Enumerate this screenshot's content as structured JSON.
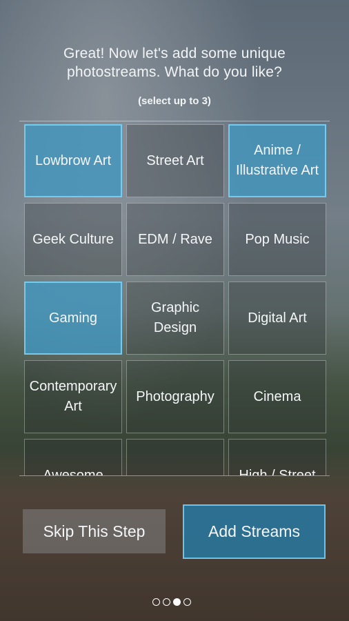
{
  "heading": {
    "line1": "Great! Now let's add some unique",
    "line2": "photostreams. What do you like?"
  },
  "subheading": "(select up to 3)",
  "tiles": [
    {
      "label": "Lowbrow Art",
      "selected": true
    },
    {
      "label": "Street Art",
      "selected": false
    },
    {
      "label": "Anime /\nIllustrative Art",
      "selected": true
    },
    {
      "label": "Geek Culture",
      "selected": false
    },
    {
      "label": "EDM / Rave",
      "selected": false
    },
    {
      "label": "Pop Music",
      "selected": false
    },
    {
      "label": "Gaming",
      "selected": true
    },
    {
      "label": "Graphic\nDesign",
      "selected": false
    },
    {
      "label": "Digital Art",
      "selected": false
    },
    {
      "label": "Contemporary\nArt",
      "selected": false
    },
    {
      "label": "Photography",
      "selected": false
    },
    {
      "label": "Cinema",
      "selected": false
    },
    {
      "label": "Awesome",
      "selected": false
    },
    {
      "label": "",
      "selected": false
    },
    {
      "label": "High / Street",
      "selected": false
    }
  ],
  "buttons": {
    "skip": "Skip This Step",
    "add": "Add Streams"
  },
  "pager": {
    "total": 4,
    "current": 3
  },
  "colors": {
    "selected_tile": "#4296be",
    "selected_border": "#78cdf0",
    "add_button": "#2878a0"
  }
}
